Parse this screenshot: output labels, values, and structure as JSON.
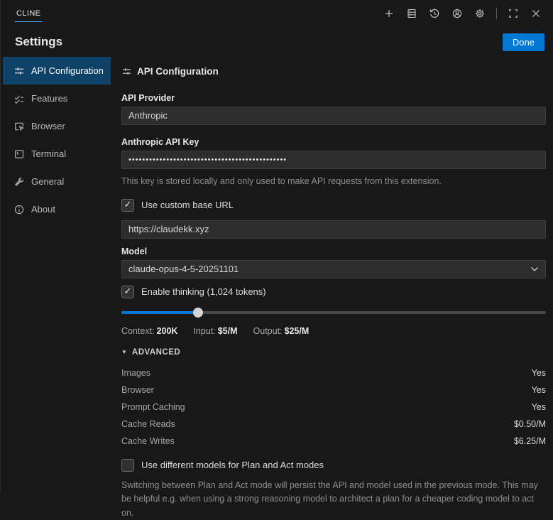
{
  "titlebar": {
    "tab_label": "CLINE",
    "icons": [
      "new-task-icon",
      "mcp-servers-icon",
      "history-icon",
      "account-icon",
      "settings-gear-icon",
      "open-in-editor-icon",
      "close-icon"
    ]
  },
  "header": {
    "title": "Settings",
    "done_label": "Done"
  },
  "sidebar": {
    "items": [
      {
        "label": "API Configuration",
        "selected": true
      },
      {
        "label": "Features",
        "selected": false
      },
      {
        "label": "Browser",
        "selected": false
      },
      {
        "label": "Terminal",
        "selected": false
      },
      {
        "label": "General",
        "selected": false
      },
      {
        "label": "About",
        "selected": false
      }
    ]
  },
  "content": {
    "section_title": "API Configuration",
    "api_provider": {
      "label": "API Provider",
      "value": "Anthropic"
    },
    "api_key": {
      "label": "Anthropic API Key",
      "masked_value": "••••••••••••••••••••••••••••••••••••••••••••••",
      "help": "This key is stored locally and only used to make API requests from this extension."
    },
    "custom_base_url": {
      "label": "Use custom base URL",
      "checked": true,
      "value": "https://claudekk.xyz"
    },
    "model": {
      "label": "Model",
      "value": "claude-opus-4-5-20251101"
    },
    "thinking": {
      "label": "Enable thinking (1,024 tokens)",
      "checked": true,
      "slider_percent": 18
    },
    "stats": [
      {
        "label": "Context:",
        "value": "200K"
      },
      {
        "label": "Input:",
        "value": "$5/M"
      },
      {
        "label": "Output:",
        "value": "$25/M"
      }
    ],
    "advanced": {
      "label": "ADVANCED",
      "rows": [
        {
          "label": "Images",
          "value": "Yes"
        },
        {
          "label": "Browser",
          "value": "Yes"
        },
        {
          "label": "Prompt Caching",
          "value": "Yes"
        },
        {
          "label": "Cache Reads",
          "value": "$0.50/M"
        },
        {
          "label": "Cache Writes",
          "value": "$6.25/M"
        }
      ]
    },
    "plan_act": {
      "label": "Use different models for Plan and Act modes",
      "checked": false,
      "description": "Switching between Plan and Act mode will persist the API and model used in the previous mode. This may be helpful e.g. when using a strong reasoning model to architect a plan for a cheaper coding model to act on."
    }
  },
  "colors": {
    "background": "#181818",
    "accent_blue": "#0078d4",
    "tab_underline": "#4dacff",
    "selected_item_bg": "#0f4268",
    "input_bg": "#2d2d2d",
    "input_border": "#3f3f3f",
    "text": "#cccccc",
    "muted_text": "#8f8f8f"
  }
}
